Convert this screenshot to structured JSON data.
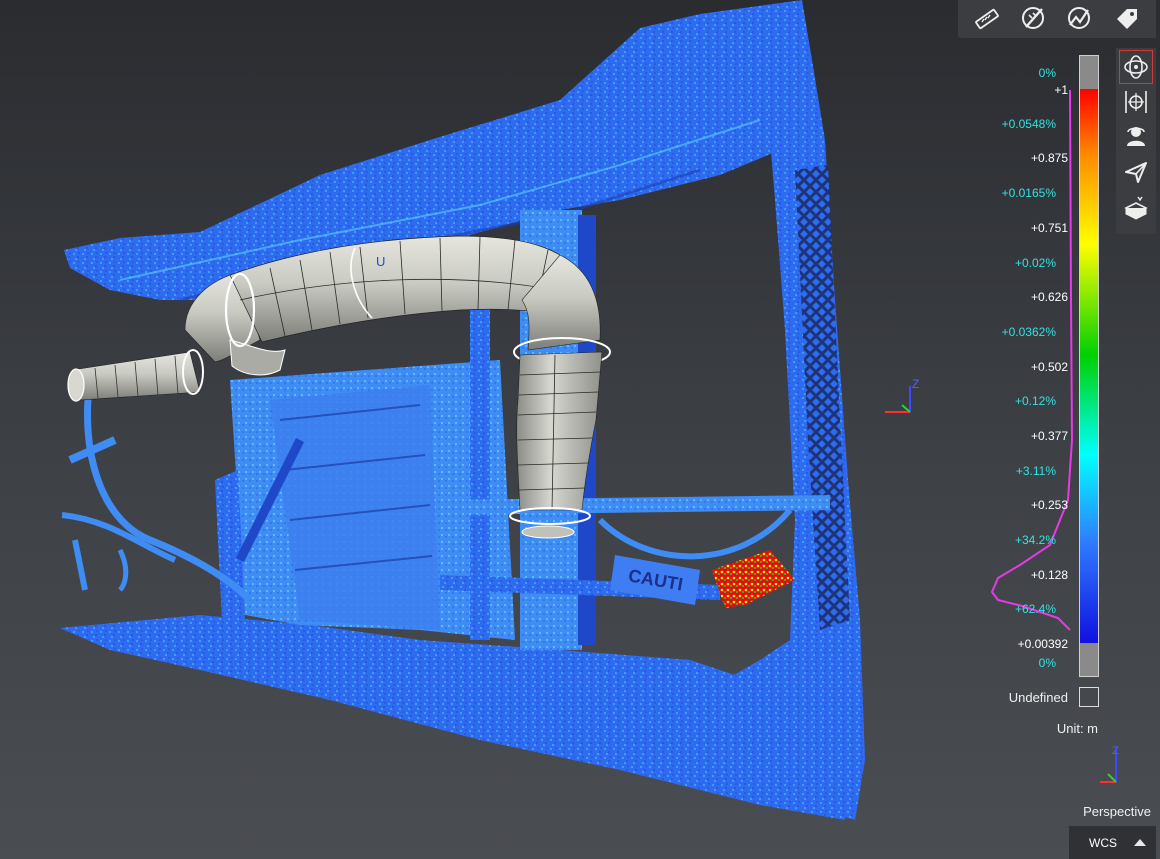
{
  "toolbar": {
    "icons": [
      "ruler-icon",
      "measure-angle-icon",
      "measure-profile-icon",
      "tag-icon"
    ]
  },
  "side_toolbar": {
    "icons": [
      "orbit-icon",
      "pan-target-icon",
      "user-view-icon",
      "fly-icon",
      "section-box-icon"
    ]
  },
  "legend": {
    "top_percent": "0%",
    "values": [
      "+1",
      "+0.875",
      "+0.751",
      "+0.626",
      "+0.502",
      "+0.377",
      "+0.253",
      "+0.128",
      "+0.00392"
    ],
    "percents": [
      "+0.0548%",
      "+0.0165%",
      "+0.02%",
      "+0.0362%",
      "+0.12%",
      "+3.11%",
      "+34.2%",
      "+62.4%"
    ],
    "bottom_percent": "0%",
    "undefined_label": "Undefined",
    "unit_label": "Unit: m"
  },
  "scene": {
    "sign_text": "CAUTI",
    "axis_z": "Z"
  },
  "footer": {
    "projection": "Perspective",
    "coordinate_system": "WCS"
  },
  "colors": {
    "background_top": "#2a2c30",
    "background_bottom": "#4a4d52",
    "cloud_blue": "#2f6bf0",
    "percent_cyan": "#31e3e3",
    "histogram_magenta": "#e838e8",
    "active_border": "#d23a3a"
  }
}
